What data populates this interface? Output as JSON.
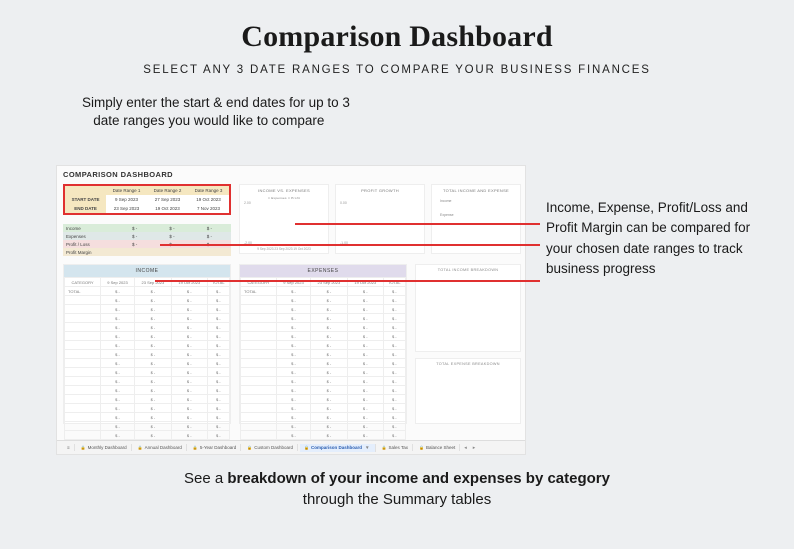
{
  "title": "Comparison Dashboard",
  "subtitle": "SELECT ANY 3 DATE RANGES TO COMPARE YOUR BUSINESS FINANCES",
  "intro_l1": "Simply enter the start & end dates for up to 3",
  "intro_l2": "date ranges you would like to compare",
  "dashboard": {
    "heading": "COMPARISON DASHBOARD",
    "date_cols": [
      "Date Range 1",
      "Date Range 2",
      "Date Range 3"
    ],
    "start_label": "START DATE",
    "end_label": "END DATE",
    "start_dates": [
      "9 Sep 2023",
      "27 Sep 2023",
      "19 Oct 2023"
    ],
    "end_dates": [
      "23 Sep 2023",
      "19 Oct 2023",
      "7 Nov 2023"
    ],
    "summary": {
      "income": "Income",
      "expenses": "Expenses",
      "profit_loss": "Profit / Loss",
      "profit_margin": "Profit Margin",
      "vals": [
        "$      -",
        "$      -",
        "$      -"
      ]
    },
    "charts": {
      "c1_title": "INCOME VS. EXPENSES",
      "c1_legend": "□ Expenses  □ Profit",
      "c2_title": "PROFIT GROWTH",
      "c3_title": "TOTAL INCOME AND EXPENSE",
      "c3_leg1": "Income",
      "c3_leg2": "Expense",
      "axis_top": "2.00",
      "axis_bot": "-2.00",
      "axis_mid1": "0.00",
      "axis_mid2": "-1.00",
      "xdates": "9 Sep 2023    23 Sep 2023    19 Oct 2023"
    },
    "income_table": {
      "title": "INCOME",
      "cols": [
        "CATEGORY",
        "9 Sep 2023",
        "23 Sep 2023",
        "19 Oct 2023",
        "TOTAL"
      ],
      "total_label": "TOTAL"
    },
    "expense_table": {
      "title": "EXPENSES",
      "cols": [
        "CATEGORY",
        "9 Sep 2023",
        "23 Sep 2023",
        "19 Oct 2023",
        "TOTAL"
      ],
      "total_label": "TOTAL"
    },
    "breakdown1": "TOTAL INCOME BREAKDOWN",
    "breakdown2": "TOTAL EXPENSE BREAKDOWN"
  },
  "tabs": [
    "Monthly Dashboard",
    "Annual Dashboard",
    "5-Year Dashboard",
    "Custom Dashboard",
    "Comparison Dashboard",
    "Sales Tax",
    "Balance Sheet"
  ],
  "side_text": "Income, Expense, Profit/Loss and Profit Margin can be compared for your chosen date ranges to track business progress",
  "footer_bold": "breakdown of your income and expenses by category",
  "footer_pre": "See a ",
  "footer_post": "through the Summary tables"
}
